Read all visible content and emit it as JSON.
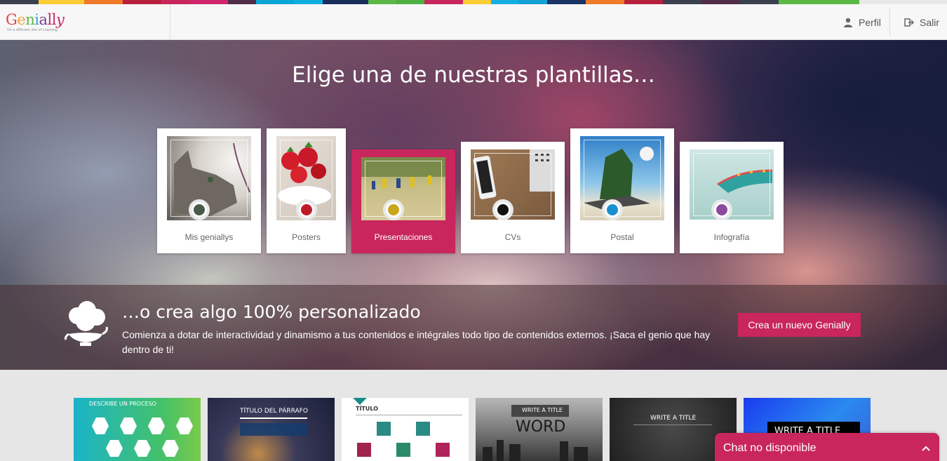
{
  "brand": {
    "name_letters": [
      "G",
      "e",
      "n",
      "i",
      "a",
      "l",
      "l",
      "y"
    ],
    "tagline": "On a different site of Learning",
    "accent": "#c8265c"
  },
  "topbar_colors": [
    "#3b4050",
    "#fbcc33",
    "#ef7a2a",
    "#b81f3d",
    "#c8265c",
    "#d0256c",
    "#522d48",
    "#0aa6d6",
    "#13aee0",
    "#1a2d5a",
    "#5cb845",
    "#4cb043",
    "#c8265c",
    "#fbcc33",
    "#15aee1",
    "#13a1d6",
    "#193465",
    "#ef7a2a",
    "#b81f3d",
    "#3b4050",
    "#522d48",
    "#3b4050",
    "#5cb845"
  ],
  "header": {
    "profile_label": "Perfil",
    "logout_label": "Salir"
  },
  "hero": {
    "title": "Elige una de nuestras plantillas…"
  },
  "categories": [
    {
      "label": "Mis geniallys",
      "dot_color": "#4a5a4a",
      "active": false
    },
    {
      "label": "Posters",
      "dot_color": "#c01a2a",
      "active": false
    },
    {
      "label": "Presentaciones",
      "dot_color": "#c8a51a",
      "active": true
    },
    {
      "label": "CVs",
      "dot_color": "#111111",
      "active": false
    },
    {
      "label": "Postal",
      "dot_color": "#1a8fcf",
      "active": false
    },
    {
      "label": "Infografía",
      "dot_color": "#8b4aa0",
      "active": false
    }
  ],
  "banner": {
    "title": "…o crea algo 100% personalizado",
    "text": "Comienza a dotar de interactividad y dinamismo a tus contenidos e intégrales todo tipo de contenidos externos. ¡Saca el genio que hay dentro de ti!",
    "cta_label": "Crea un nuevo Genially"
  },
  "templates": [
    {
      "text": "DESCRIBE UN PROCESO"
    },
    {
      "text": "TÍTULO DEL PÁRRAFO"
    },
    {
      "text": "TÍTULO"
    },
    {
      "text": "WRITE A TITLE",
      "text2": "WORD"
    },
    {
      "text": "WRITE A TITLE"
    },
    {
      "text": "WRITE A TITLE"
    }
  ],
  "chat": {
    "label": "Chat no disponible"
  }
}
